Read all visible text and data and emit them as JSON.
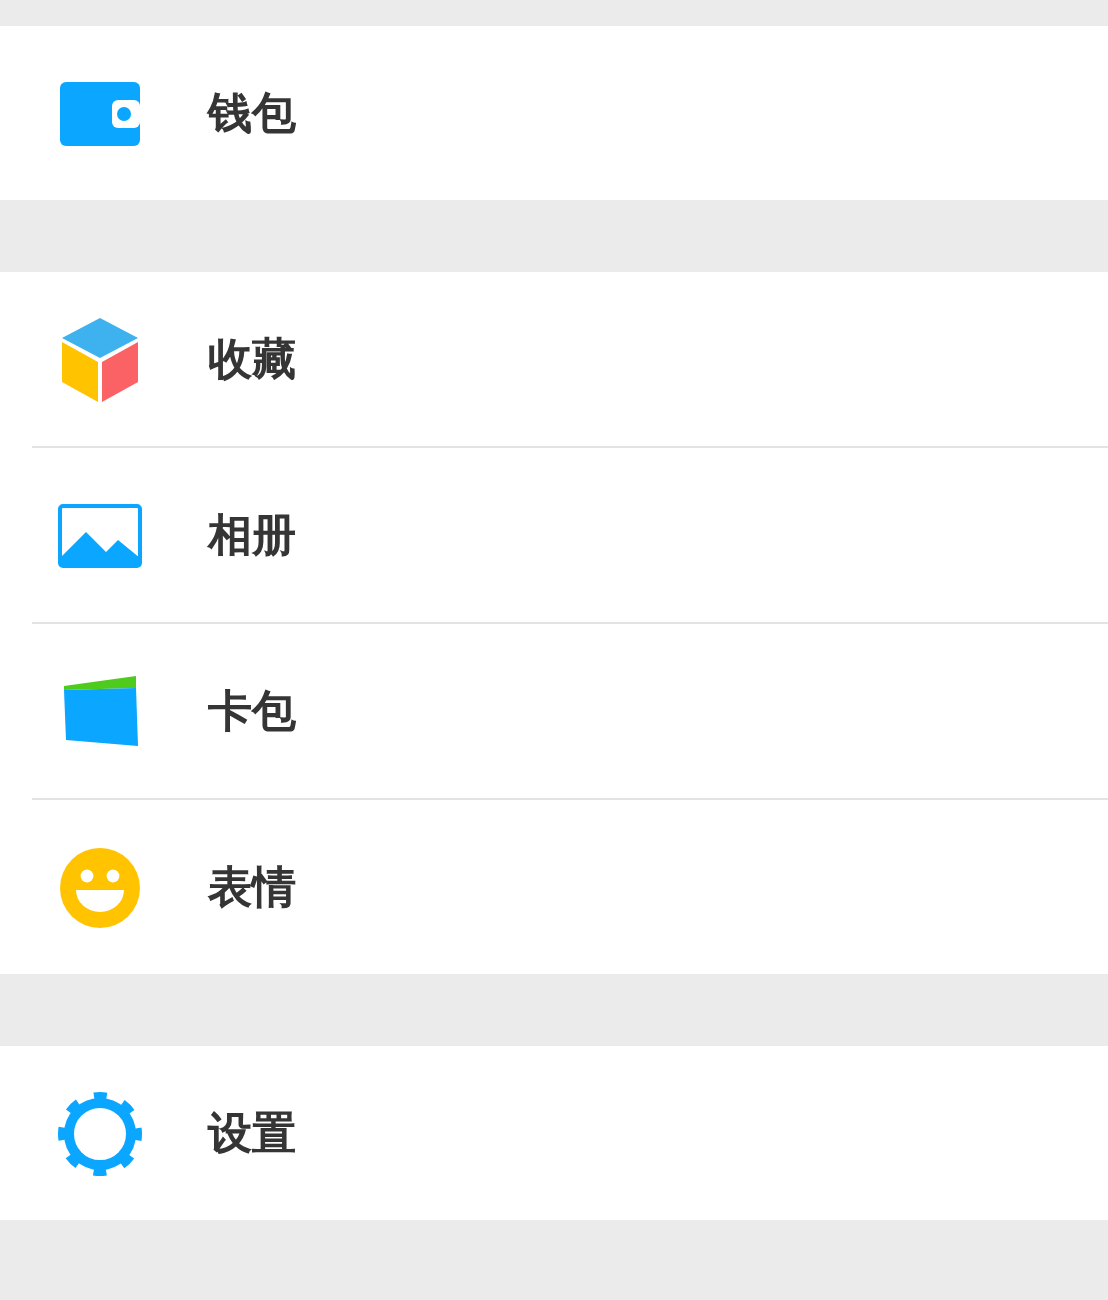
{
  "groups": [
    {
      "items": [
        {
          "label": "钱包",
          "kind": "wallet"
        }
      ]
    },
    {
      "items": [
        {
          "label": "收藏",
          "kind": "cube"
        },
        {
          "label": "相册",
          "kind": "photo"
        },
        {
          "label": "卡包",
          "kind": "card"
        },
        {
          "label": "表情",
          "kind": "smiley"
        }
      ]
    },
    {
      "items": [
        {
          "label": "设置",
          "kind": "gear"
        }
      ]
    }
  ]
}
